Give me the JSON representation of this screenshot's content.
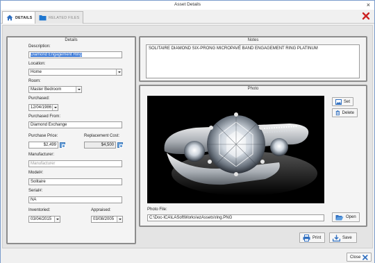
{
  "window": {
    "title": "Asset Details",
    "close_glyph": "×"
  },
  "tabs": [
    {
      "label": "DETAILS",
      "icon": "home-icon",
      "active": true
    },
    {
      "label": "RELATED FILES",
      "icon": "folder-icon",
      "active": false
    }
  ],
  "details": {
    "panel_title": "Details",
    "description_label": "Description:",
    "description_value": "Diamond Engagement Ring",
    "location_label": "Location:",
    "location_value": "Home",
    "room_label": "Room:",
    "room_value": "Master Bedroom",
    "purchased_label": "Purchased:",
    "purchased_value": "12/04/1986",
    "purchased_from_label": "Purchased From:",
    "purchased_from_value": "Diamond Exchange",
    "purchase_price_label": "Purchase Price:",
    "purchase_price_value": "$2,499",
    "replacement_cost_label": "Replacement Cost:",
    "replacement_cost_value": "$4,500",
    "manufacturer_label": "Manufacturer:",
    "manufacturer_placeholder": "Manufacturer",
    "model_label": "Model#:",
    "model_value": "Solitaire",
    "serial_label": "Serial#:",
    "serial_value": "NA",
    "inventoried_label": "Inventoried:",
    "inventoried_value": "03/04/2015",
    "appraised_label": "Appraised:",
    "appraised_value": "03/08/2005"
  },
  "notes": {
    "panel_title": "Notes",
    "value": "SOLITAIRE DIAMOND SIX-PRONG MICROPAVÉ BAND ENGAGEMENT RING PLATINUM"
  },
  "photo": {
    "panel_title": "Photo",
    "set_label": "Set",
    "delete_label": "Delete",
    "file_label": "Photo File:",
    "file_value": "C:\\Doc-ICA\\LASoftWorks\\ezAssets\\ring.PNG",
    "open_label": "Open"
  },
  "actions": {
    "print_label": "Print",
    "save_label": "Save"
  },
  "statusbar": {
    "close_label": "Close"
  },
  "colors": {
    "accent": "#2f6fc0",
    "close_red": "#cc2222",
    "folder": "#1f77d0"
  }
}
